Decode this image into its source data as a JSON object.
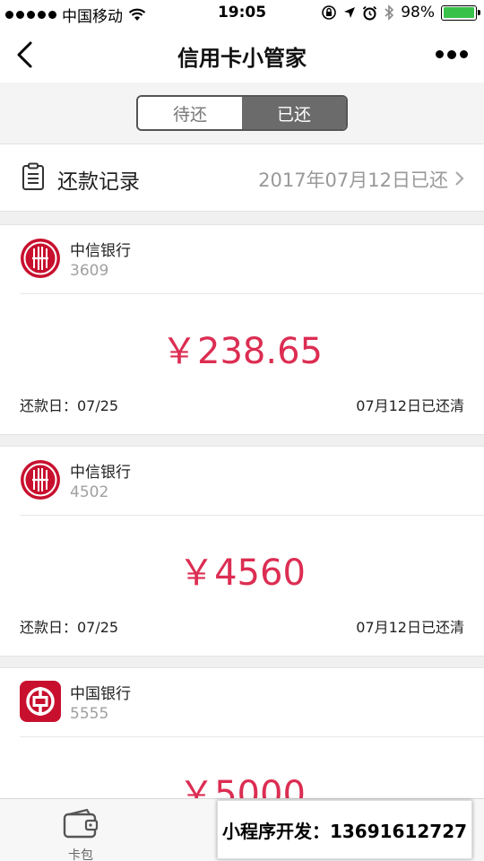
{
  "status_bar": {
    "carrier": "中国移动",
    "time": "19:05",
    "battery": "98%",
    "battery_level": 0.98,
    "battery_color": "#39c24a"
  },
  "nav": {
    "title": "信用卡小管家",
    "back_icon": "chevron-left-icon",
    "more_icon": "more-dots-icon"
  },
  "segments": [
    {
      "label": "待还",
      "active": false
    },
    {
      "label": "已还",
      "active": true
    }
  ],
  "record": {
    "label": "还款记录",
    "date_text": "2017年07月12日已还",
    "icon": "clipboard-icon"
  },
  "cards": [
    {
      "bank": "中信银行",
      "card_no": "3609",
      "amount": "￥238.65",
      "due": "还款日：07/25",
      "status": "07月12日已还清",
      "logo": "citic-logo-icon"
    },
    {
      "bank": "中信银行",
      "card_no": "4502",
      "amount": "￥4560",
      "due": "还款日：07/25",
      "status": "07月12日已还清",
      "logo": "citic-logo-icon"
    },
    {
      "bank": "中国银行",
      "card_no": "5555",
      "amount": "￥5000",
      "due": "",
      "status": "",
      "logo": "boc-logo-icon"
    }
  ],
  "tabs": [
    {
      "label": "卡包",
      "icon": "wallet-icon"
    }
  ],
  "watermark": "小程序开发：13691612727",
  "colors": {
    "amount": "#dc2d52",
    "bank_red": "#c8102e",
    "segment_active": "#6b6b6b"
  }
}
